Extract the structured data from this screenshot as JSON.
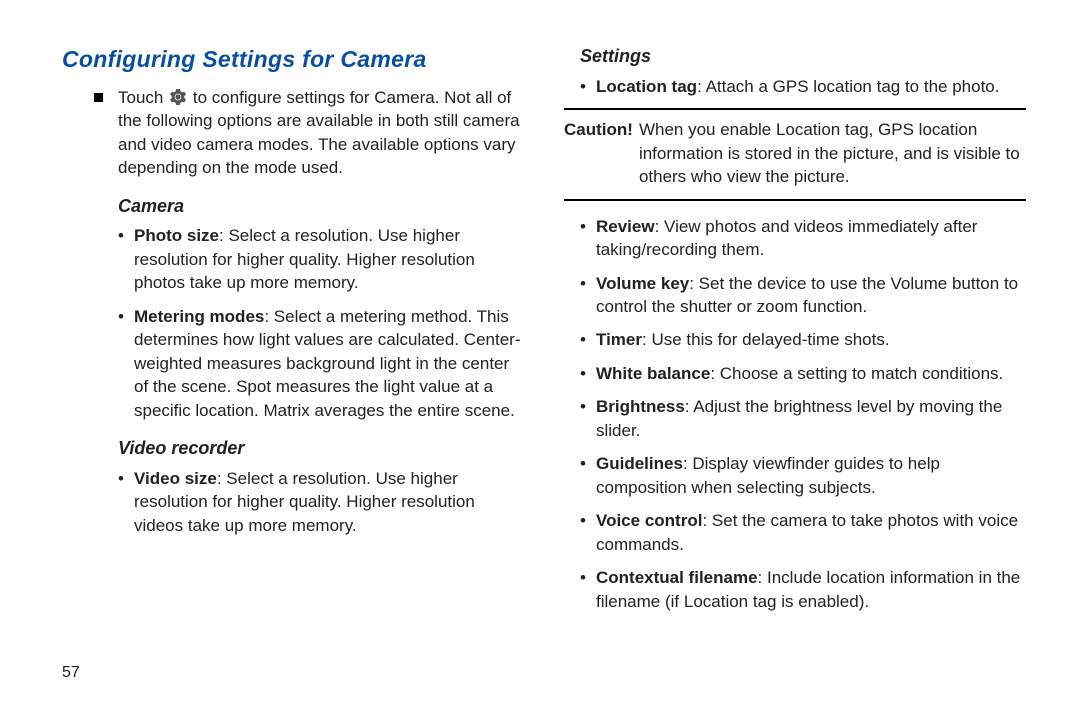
{
  "title": "Configuring Settings for Camera",
  "intro": {
    "prefix": "Touch",
    "suffix": "to configure settings for Camera. Not all of the following options are available in both still camera and video camera modes. The available options vary depending on the mode used."
  },
  "camera": {
    "heading": "Camera",
    "items": [
      {
        "term": "Photo size",
        "desc": ": Select a resolution. Use higher resolution for higher quality. Higher resolution photos take up more memory."
      },
      {
        "term": "Metering modes",
        "desc": ": Select a metering method. This determines how light values are calculated. Center-weighted measures background light in the center of the scene. Spot measures the light value at a specific location. Matrix averages the entire scene."
      }
    ]
  },
  "video": {
    "heading": "Video recorder",
    "items": [
      {
        "term": "Video size",
        "desc": ": Select a resolution. Use higher resolution for higher quality. Higher resolution videos take up more memory."
      }
    ]
  },
  "settings": {
    "heading": "Settings",
    "top_items": [
      {
        "term": "Location tag",
        "desc": ": Attach a GPS location tag to the photo."
      }
    ],
    "caution_label": "Caution!",
    "caution_text": "When you enable Location tag, GPS location information is stored in the picture, and is visible to others who view the picture.",
    "items": [
      {
        "term": "Review",
        "desc": ": View photos and videos immediately after taking/recording them."
      },
      {
        "term": "Volume key",
        "desc": ": Set the device to use the Volume button to control the shutter or zoom function."
      },
      {
        "term": "Timer",
        "desc": ": Use this for delayed-time shots."
      },
      {
        "term": "White balance",
        "desc": ": Choose a setting to match conditions."
      },
      {
        "term": "Brightness",
        "desc": ": Adjust the brightness level by moving the slider."
      },
      {
        "term": "Guidelines",
        "desc": ": Display viewfinder guides to help composition when selecting subjects."
      },
      {
        "term": "Voice control",
        "desc": ": Set the camera to take photos with voice commands."
      },
      {
        "term": "Contextual filename",
        "desc": ": Include location information in the filename (if Location tag is enabled)."
      }
    ]
  },
  "page_number": "57"
}
